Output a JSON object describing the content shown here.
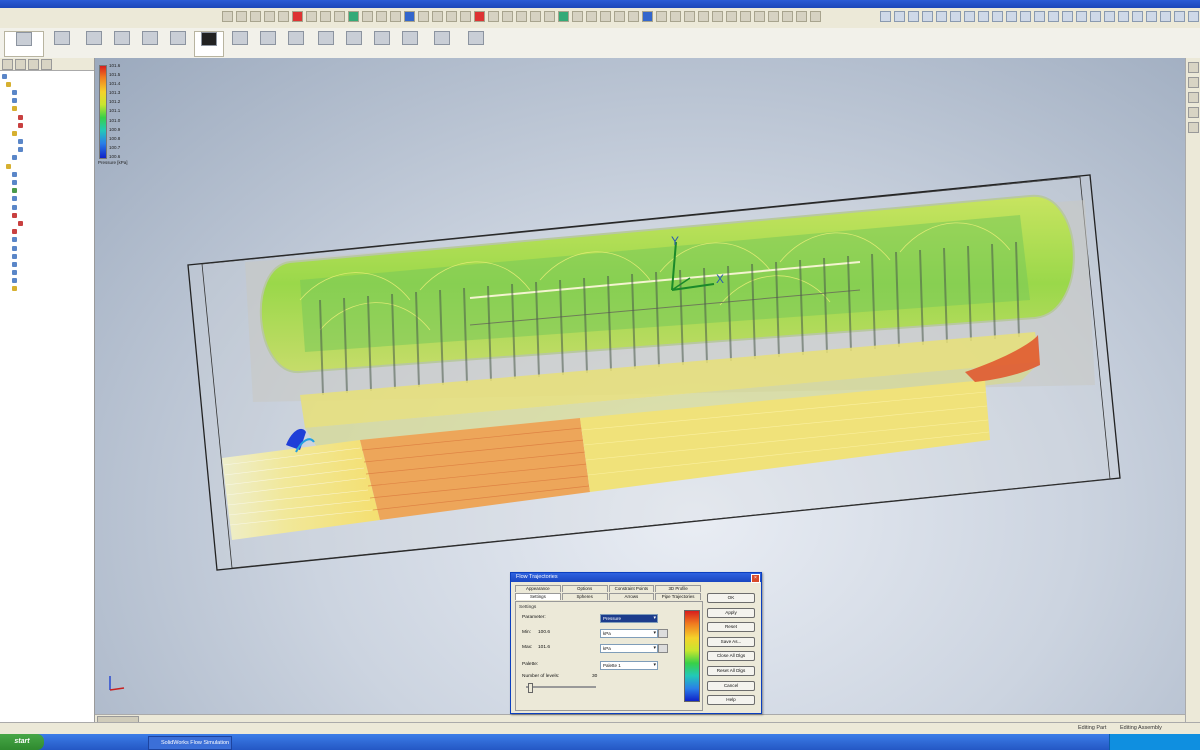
{
  "legend": {
    "values": [
      "101.6",
      "101.5",
      "101.4",
      "101.3",
      "101.2",
      "101.1",
      "101.0",
      "100.9",
      "100.8",
      "100.7",
      "100.6"
    ],
    "label": "Pressure [kPa]"
  },
  "axes": {
    "x": "X",
    "y": "Y"
  },
  "dialog": {
    "title": "Flow Trajectories",
    "tabs_row1": [
      "Appearance",
      "Options",
      "Constraint Points",
      "3D Profile"
    ],
    "tabs_row2": [
      "Settings",
      "Spheres",
      "Arrows",
      "Pipe Trajectories"
    ],
    "group_label": "Settings",
    "parameter_label": "Parameter:",
    "parameter_value": "Pressure",
    "min_label": "Min:",
    "min_value": "100.6",
    "max_label": "Max:",
    "max_value": "101.6",
    "unit_value": "kPa",
    "palette_label": "Palette:",
    "palette_value": "Palette 1",
    "levels_label": "Number of levels:",
    "levels_value": "30",
    "buttons": [
      "OK",
      "Apply",
      "Reset",
      "Save As...",
      "Close All Dlgs",
      "Reset All Dlgs",
      "Cancel",
      "Help"
    ]
  },
  "statusbar": {
    "left": "Editing Part",
    "right": "Editing Assembly"
  },
  "taskbar": {
    "start": "start",
    "task": "SolidWorks Flow Simulation"
  }
}
